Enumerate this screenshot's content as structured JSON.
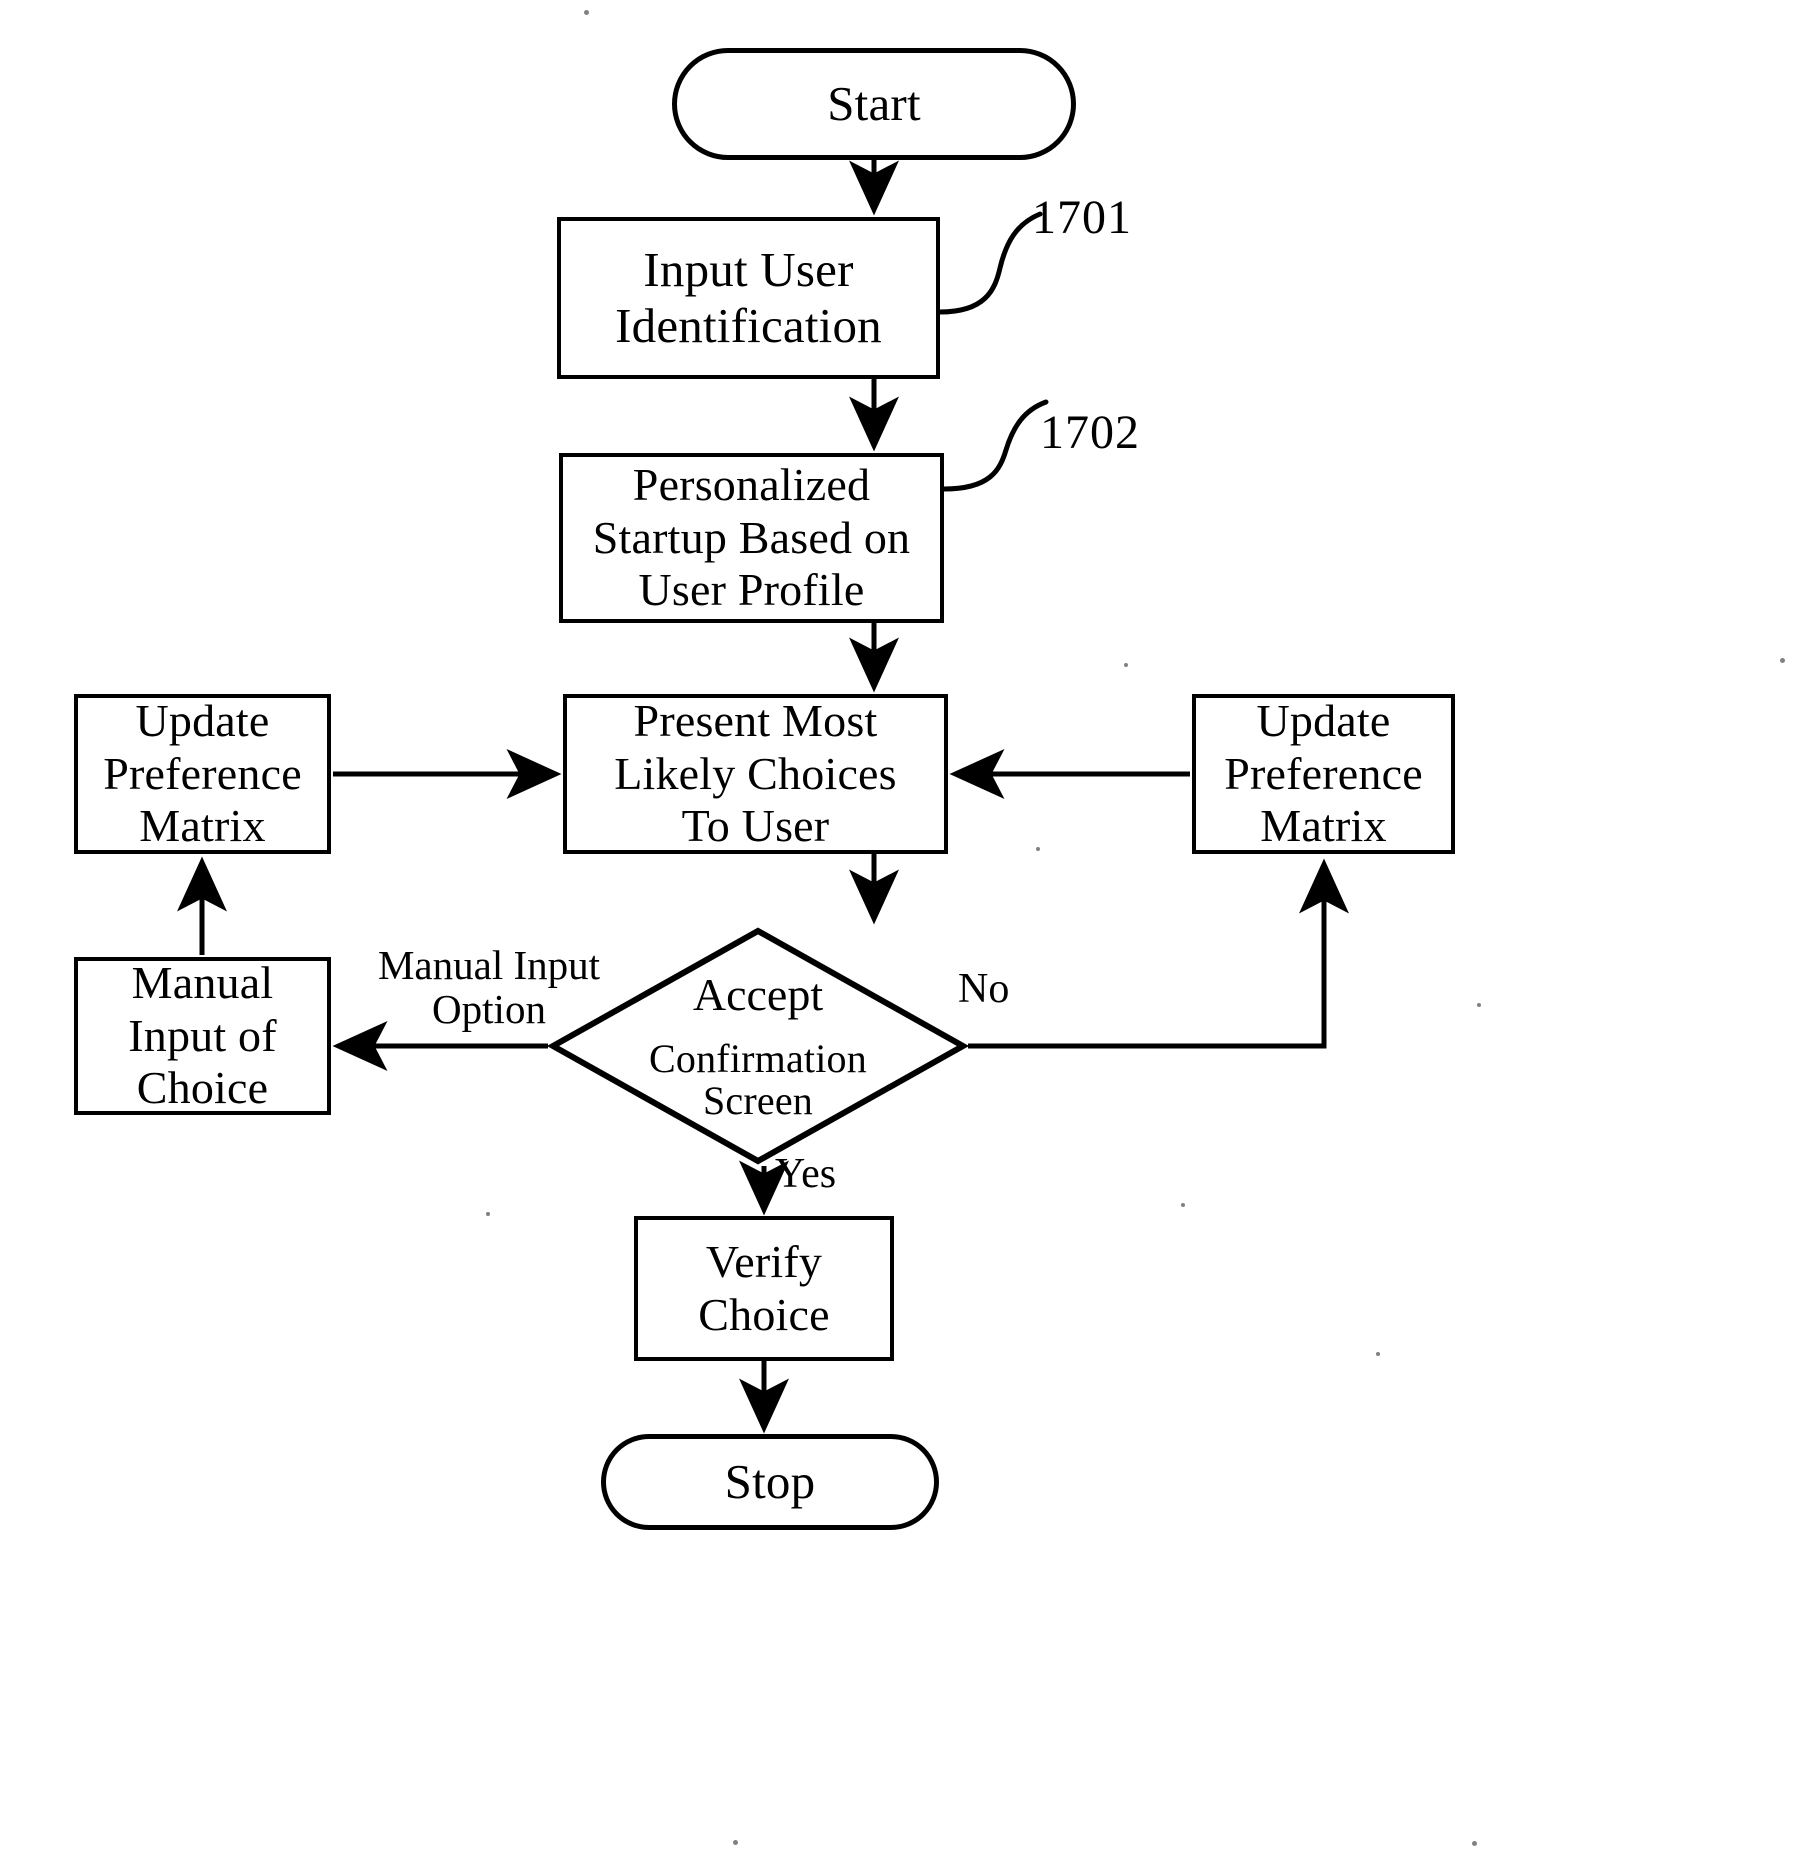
{
  "figure": {
    "kind": "flowchart",
    "background_color": "#ffffff",
    "line_color": "#000000"
  },
  "nodes": {
    "start": {
      "label": "Start",
      "shape": "terminal"
    },
    "input_user": {
      "label": "Input User\nIdentification",
      "shape": "process"
    },
    "personalized": {
      "label": "Personalized\nStartup Based on\nUser Profile",
      "shape": "process"
    },
    "present": {
      "label": "Present Most\nLikely Choices\nTo User",
      "shape": "process"
    },
    "update_left": {
      "label": "Update\nPreference\nMatrix",
      "shape": "process"
    },
    "update_right": {
      "label": "Update\nPreference\nMatrix",
      "shape": "process"
    },
    "manual_input": {
      "label": "Manual\nInput of\nChoice",
      "shape": "process"
    },
    "decision": {
      "label_line1": "Accept",
      "label_line2": "Confirmation\nScreen",
      "shape": "decision"
    },
    "verify": {
      "label": "Verify\nChoice",
      "shape": "process"
    },
    "stop": {
      "label": "Stop",
      "shape": "terminal"
    }
  },
  "edge_labels": {
    "manual_input_option": "Manual Input\nOption",
    "no": "No",
    "yes": "Yes"
  },
  "reference_numerals": {
    "input_user": "1701",
    "personalized": "1702"
  }
}
